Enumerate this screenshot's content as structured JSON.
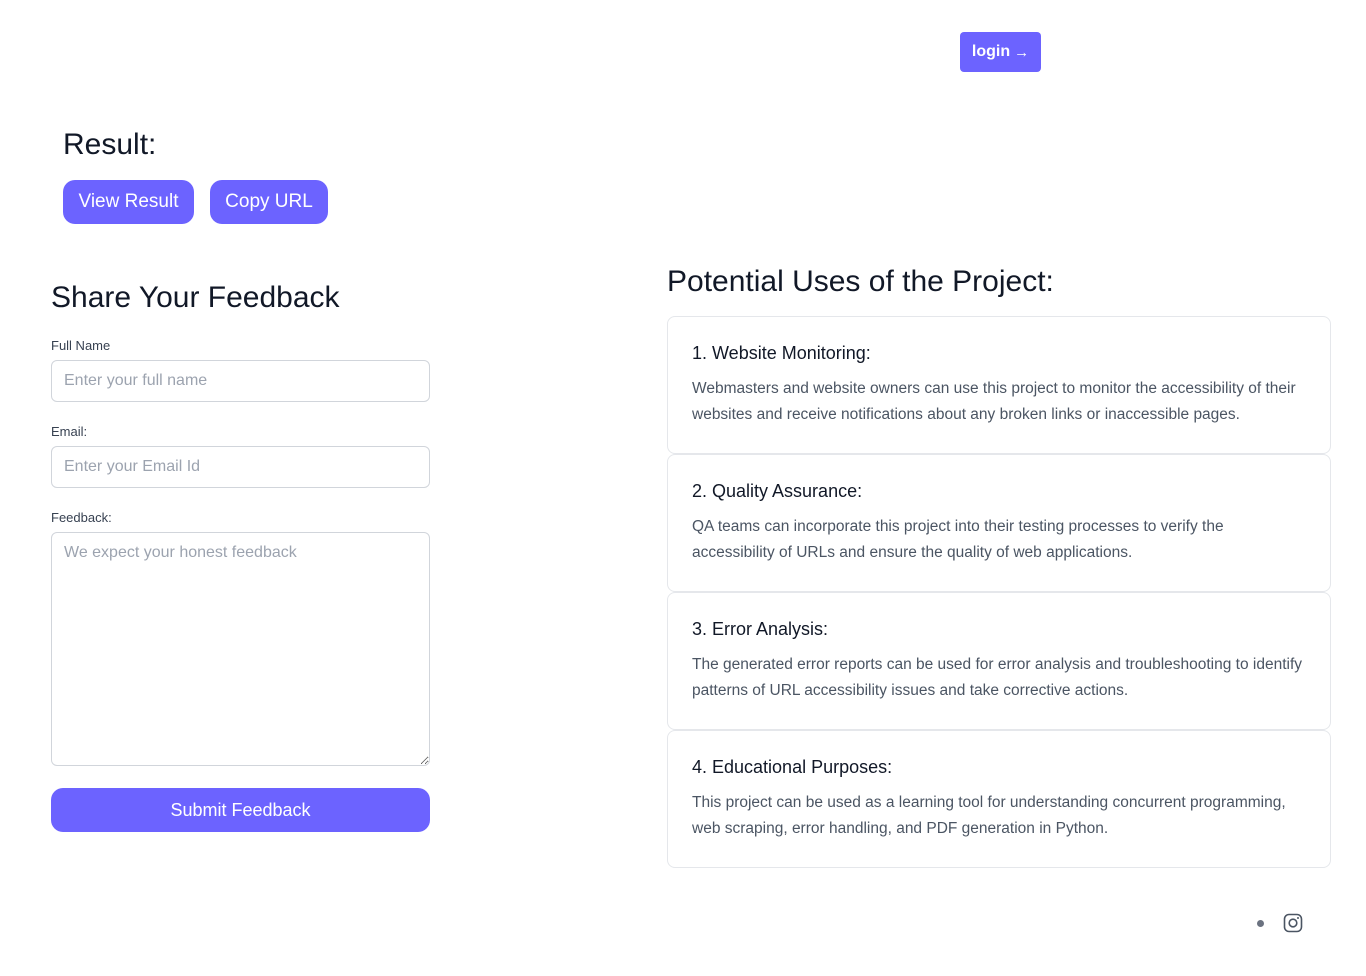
{
  "header": {
    "login_label": "login",
    "login_arrow": "→"
  },
  "result": {
    "title": "Result:",
    "view_label": "View Result",
    "copy_label": "Copy URL"
  },
  "feedback": {
    "title": "Share Your Feedback",
    "name_label": "Full Name",
    "name_placeholder": "Enter your full name",
    "email_label": "Email:",
    "email_placeholder": "Enter your Email Id",
    "feedback_label": "Feedback:",
    "feedback_placeholder": "We expect your honest feedback",
    "submit_label": "Submit Feedback"
  },
  "uses": {
    "title": "Potential Uses of the Project:",
    "items": [
      {
        "title": "1. Website Monitoring:",
        "desc": "Webmasters and website owners can use this project to monitor the accessibility of their websites and receive notifications about any broken links or inaccessible pages."
      },
      {
        "title": "2. Quality Assurance:",
        "desc": "QA teams can incorporate this project into their testing processes to verify the accessibility of URLs and ensure the quality of web applications."
      },
      {
        "title": "3. Error Analysis:",
        "desc": "The generated error reports can be used for error analysis and troubleshooting to identify patterns of URL accessibility issues and take corrective actions."
      },
      {
        "title": "4. Educational Purposes:",
        "desc": "This project can be used as a learning tool for understanding concurrent programming, web scraping, error handling, and PDF generation in Python."
      }
    ]
  },
  "footer": {
    "icons": [
      "dot-icon",
      "instagram-icon"
    ]
  },
  "colors": {
    "accent": "#6c63ff",
    "text": "#111827",
    "muted": "#4b5563",
    "border": "#e5e7eb"
  }
}
